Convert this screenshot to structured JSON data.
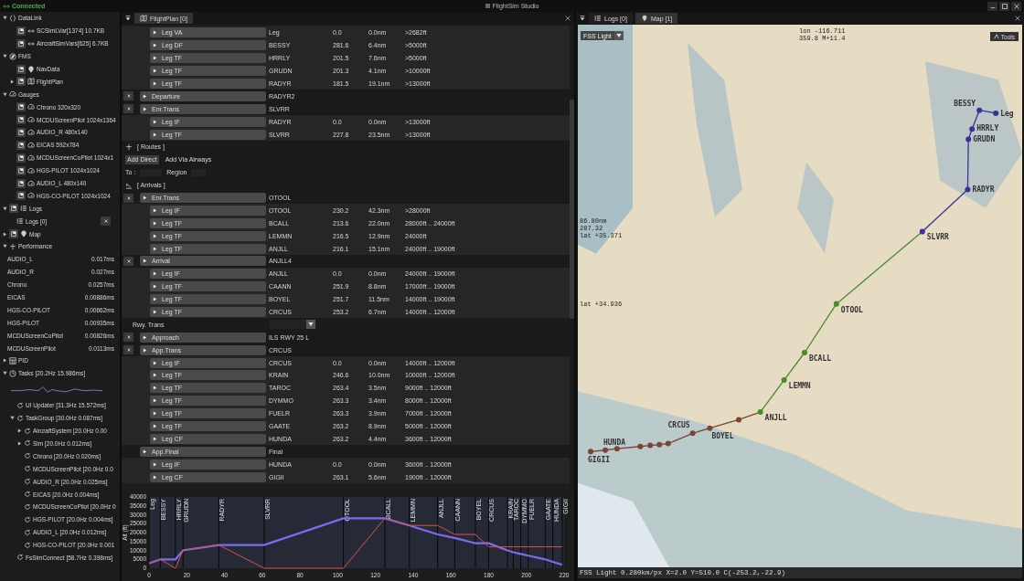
{
  "titlebar": {
    "status": "Connected",
    "title": "FlightSim Studio"
  },
  "sidebar": {
    "tree": [
      {
        "label": "DataLink",
        "expanded": true,
        "children": [
          {
            "label": "SCSimLVar[1374] 10.7KB",
            "dock": true
          },
          {
            "label": "AircraftSimVars[625] 6.7KB",
            "dock": true
          }
        ]
      },
      {
        "label": "FMS",
        "expanded": true,
        "children": [
          {
            "label": "NavData",
            "dock": true
          },
          {
            "label": "FlightPlan",
            "dock": true,
            "expanded": false
          }
        ]
      },
      {
        "label": "Gauges",
        "expanded": true,
        "children": [
          {
            "label": "Chrono 320x320",
            "dock": true
          },
          {
            "label": "MCDUScreenPilot 1024x1364",
            "dock": true
          },
          {
            "label": "AUDIO_R 480x140",
            "dock": true
          },
          {
            "label": "EICAS 592x784",
            "dock": true
          },
          {
            "label": "MCDUScreenCoPilot 1024x1",
            "dock": true
          },
          {
            "label": "HGS-PILOT 1024x1024",
            "dock": true
          },
          {
            "label": "AUDIO_L 480x140",
            "dock": true
          },
          {
            "label": "HGS-CO-PILOT 1024x1024",
            "dock": true
          }
        ]
      },
      {
        "label": "Logs",
        "dock": true,
        "expanded": true,
        "children": [
          {
            "label": "Logs [0]",
            "closable": true
          }
        ]
      },
      {
        "label": "Map",
        "dock": true,
        "expanded": false
      },
      {
        "label": "Performance",
        "expanded": true,
        "children": [
          {
            "kind": "metric",
            "label": "AUDIO_L",
            "value": "0.017ms"
          },
          {
            "kind": "metric",
            "label": "AUDIO_R",
            "value": "0.027ms"
          },
          {
            "kind": "metric",
            "label": "Chrono",
            "value": "0.0257ms"
          },
          {
            "kind": "metric",
            "label": "EICAS",
            "value": "0.00886ms"
          },
          {
            "kind": "metric",
            "label": "HGS-CO-PILOT",
            "value": "0.00662ms"
          },
          {
            "kind": "metric",
            "label": "HGS-PILOT",
            "value": "0.00935ms"
          },
          {
            "kind": "metric",
            "label": "MCDUScreenCoPilot",
            "value": "0.00826ms"
          },
          {
            "kind": "metric",
            "label": "MCDUScreenPilot",
            "value": "0.0113ms"
          }
        ]
      },
      {
        "label": "PID",
        "expanded": false
      },
      {
        "label": "Tasks [20.2Hz 15.986ms]",
        "expanded": true,
        "children": [
          {
            "kind": "sparkline"
          },
          {
            "label": "UI Updater [31.3Hz 15.572ms]"
          },
          {
            "label": "TaskGroup [30.0Hz 0.087ms]",
            "expanded": true,
            "children": [
              {
                "label": "AircraftSystem [20.0Hz 0.00",
                "expanded": false
              },
              {
                "label": "Sim [20.0Hz 0.012ms]",
                "expanded": false
              },
              {
                "label": "Chrono [20.0Hz 0.020ms]"
              },
              {
                "label": "MCDUScreenPilot [20.0Hz 0.0"
              },
              {
                "label": "AUDIO_R [20.0Hz 0.025ms]"
              },
              {
                "label": "EICAS [20.0Hz 0.004ms]"
              },
              {
                "label": "MCDUScreenCoPilot [20.0Hz 0"
              },
              {
                "label": "HGS-PILOT [20.0Hz 0.004ms]"
              },
              {
                "label": "AUDIO_L [20.0Hz 0.012ms]"
              },
              {
                "label": "HGS-CO-PILOT [20.0Hz 0.001"
              }
            ]
          },
          {
            "label": "FsSimConnect [58.7Hz 0.398ms]"
          }
        ]
      }
    ]
  },
  "flightplan": {
    "tab": "FlightPlan [0]",
    "rows": [
      {
        "kind": "leg",
        "label": "Leg VA",
        "ident": "Leg",
        "course": "0.0",
        "distance": "0.0nm",
        "altitude": ">2682ft"
      },
      {
        "kind": "leg",
        "label": "Leg DF",
        "ident": "BESSY",
        "course": "281.6",
        "distance": "6.4nm",
        "altitude": ">5000ft"
      },
      {
        "kind": "leg",
        "label": "Leg TF",
        "ident": "HRRLY",
        "course": "201.5",
        "distance": "7.6nm",
        "altitude": ">5000ft"
      },
      {
        "kind": "leg",
        "label": "Leg TF",
        "ident": "GRUDN",
        "course": "201.3",
        "distance": "4.1nm",
        "altitude": ">10000ft"
      },
      {
        "kind": "leg",
        "label": "Leg TF",
        "ident": "RADYR",
        "course": "181.5",
        "distance": "19.1nm",
        "altitude": ">13000ft"
      },
      {
        "kind": "segment",
        "removable": true,
        "label": "Departure",
        "ident": "RADYR2"
      },
      {
        "kind": "segment",
        "removable": true,
        "label": "Enr.Trans",
        "ident": "SLVRR"
      },
      {
        "kind": "leg",
        "label": "Leg IF",
        "ident": "RADYR",
        "course": "0.0",
        "distance": "0.0nm",
        "altitude": ">13000ft"
      },
      {
        "kind": "leg",
        "label": "Leg TF",
        "ident": "SLVRR",
        "course": "227.8",
        "distance": "23.5nm",
        "altitude": ">13000ft"
      },
      {
        "kind": "section",
        "label": "[ Routes ]"
      },
      {
        "kind": "buttons",
        "buttons": [
          {
            "label": "Add Direct",
            "selected": true
          },
          {
            "label": "Add Via Airways",
            "selected": false
          }
        ]
      },
      {
        "kind": "fields",
        "to": "To :",
        "region": "Region"
      },
      {
        "kind": "section",
        "label": "[ Arrivals ]"
      },
      {
        "kind": "segment",
        "removable": true,
        "label": "Enr.Trans",
        "ident": "OTOOL"
      },
      {
        "kind": "leg",
        "label": "Leg IF",
        "ident": "OTOOL",
        "course": "230.2",
        "distance": "42.3nm",
        "altitude": ">28000ft"
      },
      {
        "kind": "leg",
        "label": "Leg TF",
        "ident": "BCALL",
        "course": "213.6",
        "distance": "22.0nm",
        "altitude": "28000ft .. 24000ft"
      },
      {
        "kind": "leg",
        "label": "Leg TF",
        "ident": "LEMMN",
        "course": "216.5",
        "distance": "12.9nm",
        "altitude": "24000ft"
      },
      {
        "kind": "leg",
        "label": "Leg TF",
        "ident": "ANJLL",
        "course": "216.1",
        "distance": "15.1nm",
        "altitude": "24000ft .. 19000ft"
      },
      {
        "kind": "segment",
        "removable": true,
        "label": "Arrival",
        "ident": "ANJLL4"
      },
      {
        "kind": "leg",
        "label": "Leg IF",
        "ident": "ANJLL",
        "course": "0.0",
        "distance": "0.0nm",
        "altitude": "24000ft .. 19000ft"
      },
      {
        "kind": "leg",
        "label": "Leg TF",
        "ident": "CAANN",
        "course": "251.9",
        "distance": "8.8nm",
        "altitude": "17000ft .. 19000ft"
      },
      {
        "kind": "leg",
        "label": "Leg TF",
        "ident": "BOYEL",
        "course": "251.7",
        "distance": "11.5nm",
        "altitude": "14000ft .. 19000ft"
      },
      {
        "kind": "leg",
        "label": "Leg TF",
        "ident": "CRCUS",
        "course": "253.2",
        "distance": "6.7nm",
        "altitude": "14000ft .. 12000ft"
      },
      {
        "kind": "dropdown",
        "label": "Rwy. Trans"
      },
      {
        "kind": "segment",
        "removable": true,
        "label": "Approach",
        "ident": "ILS RWY 25 L"
      },
      {
        "kind": "segment",
        "removable": true,
        "label": "App.Trans",
        "ident": "CRCUS"
      },
      {
        "kind": "leg",
        "label": "Leg IF",
        "ident": "CRCUS",
        "course": "0.0",
        "distance": "0.0nm",
        "altitude": "14000ft .. 12000ft"
      },
      {
        "kind": "leg",
        "label": "Leg TF",
        "ident": "KRAIN",
        "course": "246.6",
        "distance": "10.0nm",
        "altitude": "10000ft .. 12000ft"
      },
      {
        "kind": "leg",
        "label": "Leg TF",
        "ident": "TAROC",
        "course": "263.4",
        "distance": "3.5nm",
        "altitude": "9000ft .. 12000ft"
      },
      {
        "kind": "leg",
        "label": "Leg TF",
        "ident": "DYMMO",
        "course": "263.3",
        "distance": "3.4nm",
        "altitude": "8000ft .. 12000ft"
      },
      {
        "kind": "leg",
        "label": "Leg TF",
        "ident": "FUELR",
        "course": "263.3",
        "distance": "3.9nm",
        "altitude": "7000ft .. 12000ft"
      },
      {
        "kind": "leg",
        "label": "Leg TF",
        "ident": "GAATE",
        "course": "263.2",
        "distance": "8.9nm",
        "altitude": "5000ft .. 12000ft"
      },
      {
        "kind": "leg",
        "label": "Leg CF",
        "ident": "HUNDA",
        "course": "263.2",
        "distance": "4.4nm",
        "altitude": "3600ft .. 12000ft"
      },
      {
        "kind": "segment",
        "removable": false,
        "label": "App.Final",
        "ident": "Final"
      },
      {
        "kind": "leg",
        "label": "Leg IF",
        "ident": "HUNDA",
        "course": "0.0",
        "distance": "0.0nm",
        "altitude": "3600ft .. 12000ft"
      },
      {
        "kind": "leg",
        "label": "Leg CF",
        "ident": "GIGII",
        "course": "263.1",
        "distance": "5.6nm",
        "altitude": "1900ft .. 12000ft"
      }
    ],
    "chart_data": {
      "type": "line",
      "ylabel": "Alt (ft)",
      "xlim": [
        0,
        220
      ],
      "ylim": [
        0,
        40000
      ],
      "grid": true,
      "xticks": [
        0,
        20,
        40,
        60,
        80,
        100,
        120,
        140,
        160,
        180,
        200,
        220
      ],
      "yticks": [
        0,
        5000,
        10000,
        15000,
        20000,
        25000,
        30000,
        35000,
        40000
      ],
      "x": [
        0,
        6,
        14,
        18,
        37,
        61,
        103,
        125,
        138,
        153,
        162,
        173,
        180,
        190,
        193,
        197,
        201,
        210,
        214,
        219
      ],
      "series": [
        {
          "color": "#7b6cf0",
          "values": [
            2700,
            5000,
            5000,
            10000,
            13000,
            13000,
            28000,
            28000,
            24000,
            19000,
            17000,
            14000,
            14000,
            10000,
            9000,
            8000,
            7000,
            5000,
            3600,
            1900
          ]
        },
        {
          "color": "#e0504a",
          "values": [
            2700,
            5000,
            0,
            10000,
            13000,
            0,
            0,
            28000,
            24000,
            24000,
            19000,
            19000,
            12000,
            12000,
            12000,
            12000,
            12000,
            12000,
            12000,
            12000
          ]
        }
      ],
      "annotations": [
        "Leg",
        "BESSY",
        "HRRLY",
        "GRUDN",
        "RADYR",
        "SLVRR",
        "OTOOL",
        "BCALL",
        "LEMMN",
        "ANJLL",
        "CAANN",
        "BOYEL",
        "CRCUS",
        "KRAIN",
        "TAROC",
        "DYMMO",
        "FUELR",
        "GAATE",
        "HUNDA",
        "GIGII"
      ]
    }
  },
  "map": {
    "tabs": [
      {
        "label": "Logs [0]",
        "selected": false
      },
      {
        "label": "Map [1]",
        "selected": true
      }
    ],
    "layer": "FSS Light",
    "lon": "lon -116.711",
    "heading": "359.8 M+11.4",
    "tools": "Tools",
    "measure": [
      "86.80nm",
      "287.32",
      "lat +35.371"
    ],
    "lat_marker": "lat +34.936",
    "status": "FSS Light 0.280km/px X=2.0 Y=510.0 C(-253.2,-22.9)",
    "waypoints": [
      {
        "label": "Leg",
        "color": "#3b3196"
      },
      {
        "label": "BESSY",
        "color": "#3b3196"
      },
      {
        "label": "HRRLY",
        "color": "#3b3196"
      },
      {
        "label": "GRUDN",
        "color": "#3b3196"
      },
      {
        "label": "RADYR",
        "color": "#3b3196"
      },
      {
        "label": "SLVRR",
        "color": "#3b3196"
      },
      {
        "label": "OTOOL",
        "color": "#4a8a2a"
      },
      {
        "label": "BCALL",
        "color": "#4a8a2a"
      },
      {
        "label": "LEMMN",
        "color": "#4a8a2a"
      },
      {
        "label": "ANJLL",
        "color": "#4a8a2a"
      },
      {
        "color": "#7a4632"
      },
      {
        "label": "BOYEL",
        "color": "#7a4632"
      },
      {
        "label": "CRCUS",
        "color": "#7a4632"
      },
      {
        "color": "#7a4632"
      },
      {
        "color": "#7a4632"
      },
      {
        "color": "#7a4632"
      },
      {
        "color": "#7a4632"
      },
      {
        "color": "#7a4632"
      },
      {
        "label": "HUNDA",
        "color": "#7a4632"
      },
      {
        "label": "GIGII",
        "color": "#7a4632"
      }
    ]
  }
}
